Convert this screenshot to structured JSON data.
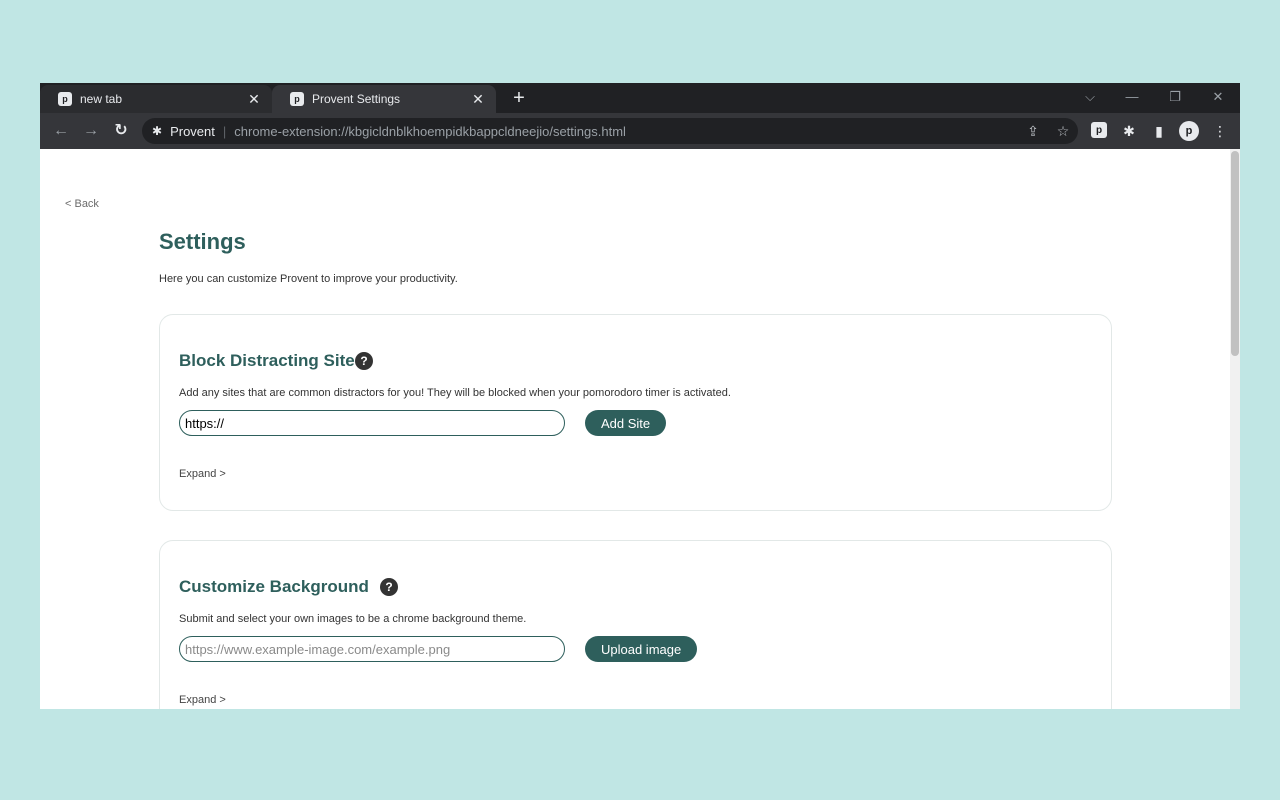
{
  "browser": {
    "tabs": [
      {
        "title": "new tab",
        "close": "✕"
      },
      {
        "title": "Provent Settings",
        "close": "✕"
      }
    ],
    "new_tab": "+",
    "favicon_letter": "p",
    "window_controls": {
      "dropdown": "⌵",
      "minimize": "—",
      "restore": "❐",
      "close": "✕"
    },
    "nav": {
      "back": "←",
      "forward": "→",
      "reload": "↻"
    },
    "omnibox": {
      "site_name": "Provent",
      "separator": "|",
      "url": "chrome-extension://kbgicldnblkhoempidkbappcldneejio/settings.html",
      "share_icon": "⇪",
      "bookmark_icon": "☆"
    },
    "toolbar_icons": {
      "extension_p": "p",
      "puzzle": "✱",
      "sidepanel": "▮",
      "profile": "p",
      "menu": "⋮"
    }
  },
  "page": {
    "back_link": "< Back",
    "title": "Settings",
    "subtitle": "Here you can customize Provent to improve your productivity.",
    "sections": [
      {
        "title": "Block Distracting Sites",
        "help": "?",
        "description": "Add any sites that are common distractors for you! They will be blocked when your pomorodoro timer is activated.",
        "input_value": "https://",
        "input_placeholder": "",
        "button": "Add Site",
        "expand": "Expand >"
      },
      {
        "title": "Customize Background",
        "help": "?",
        "description": "Submit and select your own images to be a chrome background theme.",
        "input_value": "",
        "input_placeholder": "https://www.example-image.com/example.png",
        "button": "Upload image",
        "expand": "Expand >"
      }
    ]
  },
  "colors": {
    "background": "#c0e6e4",
    "accent": "#2e5f5c",
    "chrome_dark": "#202124",
    "chrome_toolbar": "#35363a"
  }
}
